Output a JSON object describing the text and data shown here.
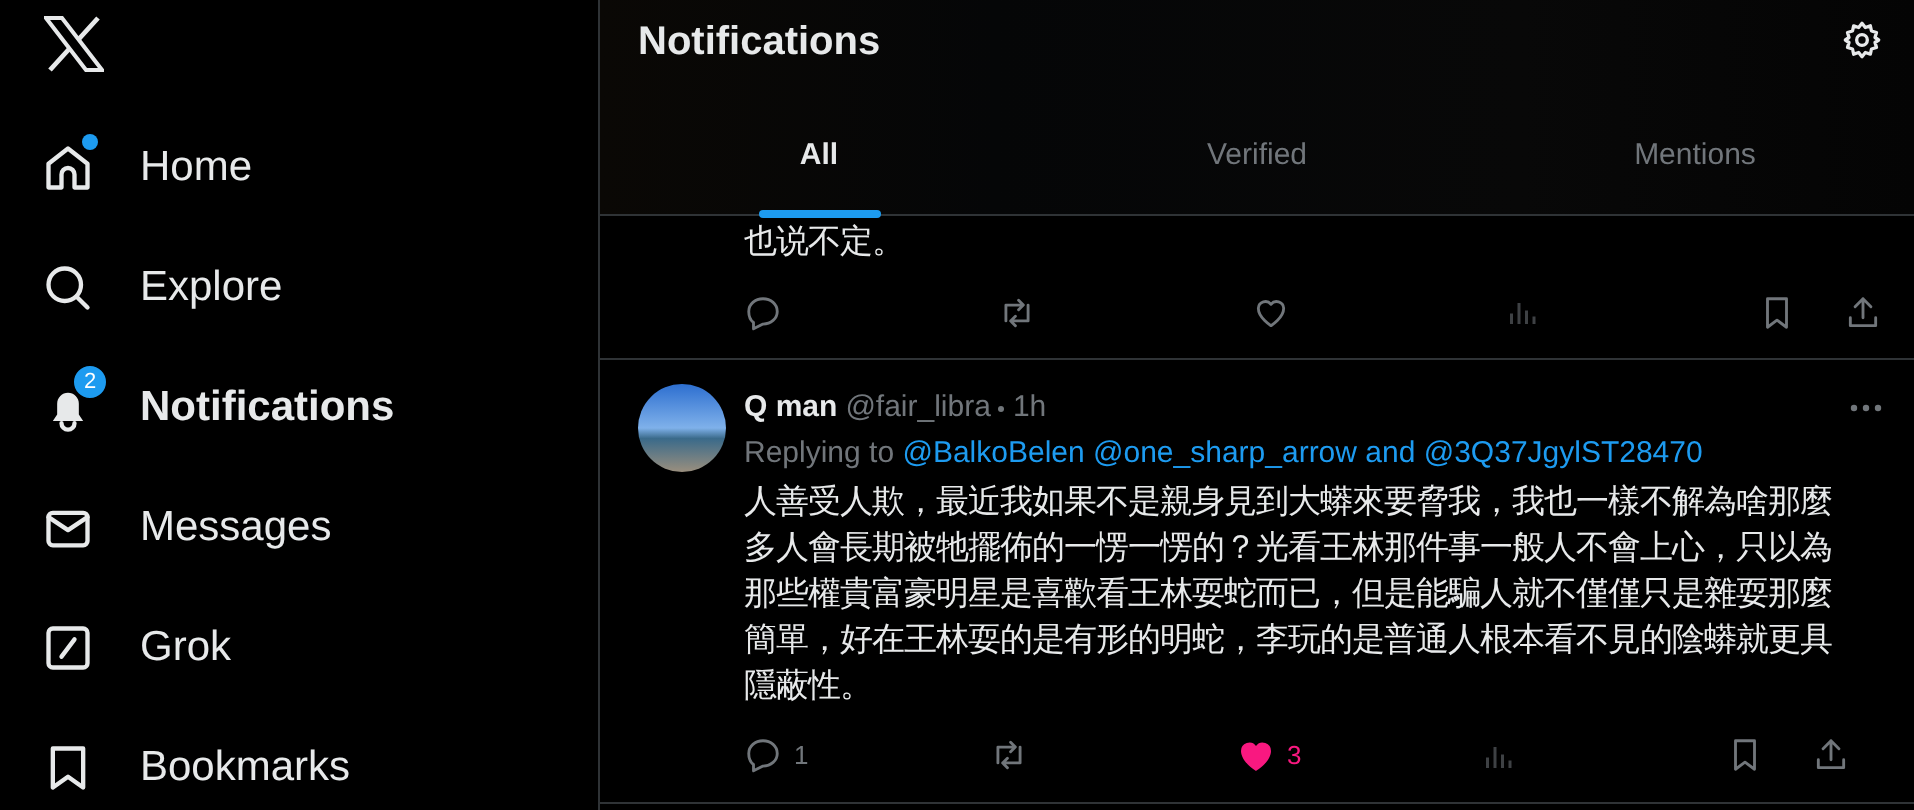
{
  "sidebar": {
    "items": [
      {
        "kind": "home",
        "label": "Home",
        "selected": false,
        "new_dot": true
      },
      {
        "kind": "explore",
        "label": "Explore",
        "selected": false,
        "new_dot": false
      },
      {
        "kind": "notifications",
        "label": "Notifications",
        "selected": true,
        "new_dot": false,
        "badge": "2"
      },
      {
        "kind": "messages",
        "label": "Messages",
        "selected": false,
        "new_dot": false
      },
      {
        "kind": "grok",
        "label": "Grok",
        "selected": false,
        "new_dot": false
      },
      {
        "kind": "bookmarks",
        "label": "Bookmarks",
        "selected": false,
        "new_dot": false
      }
    ]
  },
  "header": {
    "title": "Notifications"
  },
  "tabs": [
    {
      "label": "All",
      "selected": true
    },
    {
      "label": "Verified",
      "selected": false
    },
    {
      "label": "Mentions",
      "selected": false
    }
  ],
  "posts": [
    {
      "text": "也说不定。",
      "liked": false
    },
    {
      "name": "Q man",
      "handle": "@fair_libra",
      "time": "1h",
      "replying_label": "Replying to",
      "replying_to": [
        "@BalkoBelen",
        "@one_sharp_arrow",
        "and",
        "@3Q37JgylST28470"
      ],
      "text": "人善受人欺，最近我如果不是親身見到大蟒來要脅我，我也一樣不解為啥那麼多人會長期被牠擺佈的一愣一愣的？光看王林那件事一般人不會上心，只以為那些權貴富豪明星是喜歡看王林耍蛇而已，但是能騙人就不僅僅只是雜耍那麼簡單，好在王林耍的是有形的明蛇，李玩的是普通人根本看不見的陰蟒就更具隱蔽性。",
      "liked": true,
      "actions": {
        "replies": "1",
        "likes": "3"
      }
    }
  ]
}
